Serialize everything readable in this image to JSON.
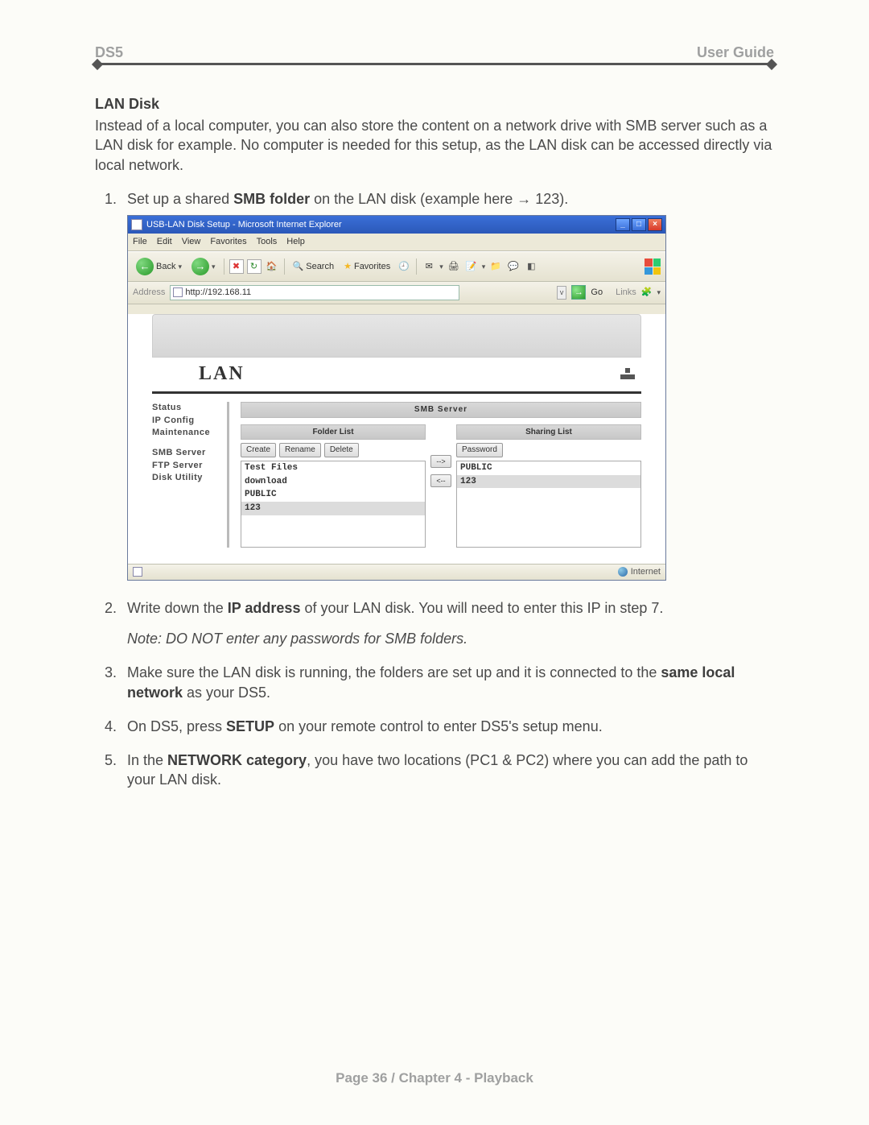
{
  "header": {
    "left": "DS5",
    "right": "User Guide"
  },
  "section_title": "LAN Disk",
  "intro": "Instead of a local computer, you can also store the content on a network drive with SMB server such as a LAN disk for example. No computer is needed for this setup, as the LAN disk can be accessed directly via local network.",
  "steps": {
    "s1_a": "Set up a shared ",
    "s1_b": "SMB folder",
    "s1_c": " on the LAN disk (example here → 123).",
    "s2_a": "Write down the ",
    "s2_b": "IP address",
    "s2_c": " of your LAN disk. You will need to enter this IP in step 7.",
    "note": "Note: DO NOT enter any passwords for SMB folders.",
    "s3_a": "Make sure the LAN disk is running, the folders are set up and it is connected to the ",
    "s3_b": "same local network",
    "s3_c": " as your DS5.",
    "s4_a": "On DS5, press ",
    "s4_b": "SETUP",
    "s4_c": " on your remote control to enter DS5's setup menu.",
    "s5_a": "In the ",
    "s5_b": "NETWORK category",
    "s5_c": ", you have two locations (PC1 & PC2) where you can add the path to your LAN disk."
  },
  "ie": {
    "title": "USB-LAN Disk Setup - Microsoft Internet Explorer",
    "menu": [
      "File",
      "Edit",
      "View",
      "Favorites",
      "Tools",
      "Help"
    ],
    "back": "Back",
    "search": "Search",
    "favorites": "Favorites",
    "addr_label": "Address",
    "addr_url": "http://192.168.11",
    "go": "Go",
    "links": "Links",
    "hero": "LAN",
    "sidebar": {
      "g1": [
        "Status",
        "IP Config",
        "Maintenance"
      ],
      "g2": [
        "SMB Server",
        "FTP Server",
        "Disk Utility"
      ]
    },
    "panel_main": "SMB Server",
    "folder_h": "Folder List",
    "sharing_h": "Sharing List",
    "btns": {
      "create": "Create",
      "rename": "Rename",
      "delete": "Delete",
      "password": "Password"
    },
    "xfer": {
      "right": "-->",
      "left": "<--"
    },
    "folders": [
      "Test Files",
      "download",
      "PUBLIC",
      "123"
    ],
    "shares": [
      "PUBLIC",
      "123"
    ],
    "status_zone": "Internet"
  },
  "footer": "Page 36  /  Chapter 4 - Playback"
}
